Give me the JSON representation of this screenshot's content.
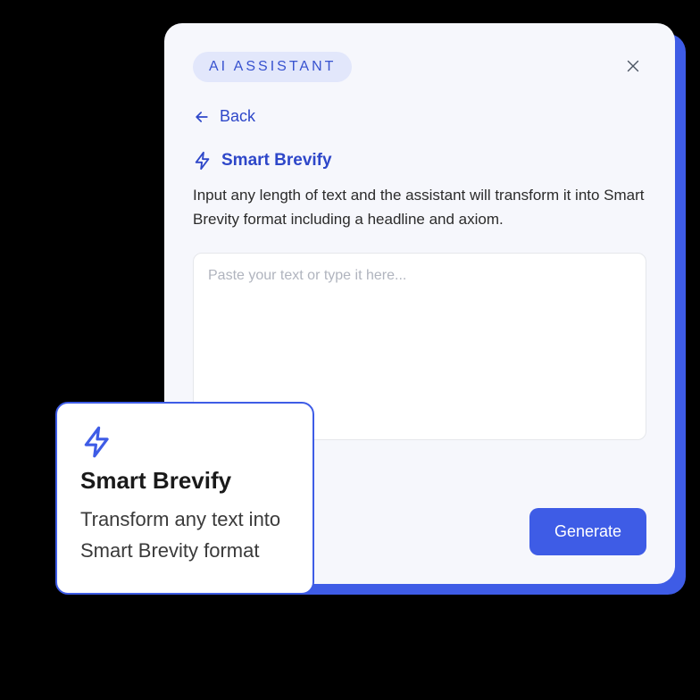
{
  "panel": {
    "badge": "AI ASSISTANT",
    "back_label": "Back",
    "section_title": "Smart Brevify",
    "description": "Input any length of text and the assistant will transform it into Smart Brevity format including a headline and axiom.",
    "textarea_placeholder": "Paste your text or type it here...",
    "generate_label": "Generate"
  },
  "card": {
    "title": "Smart Brevify",
    "description": "Transform any text into Smart Brevity format"
  }
}
